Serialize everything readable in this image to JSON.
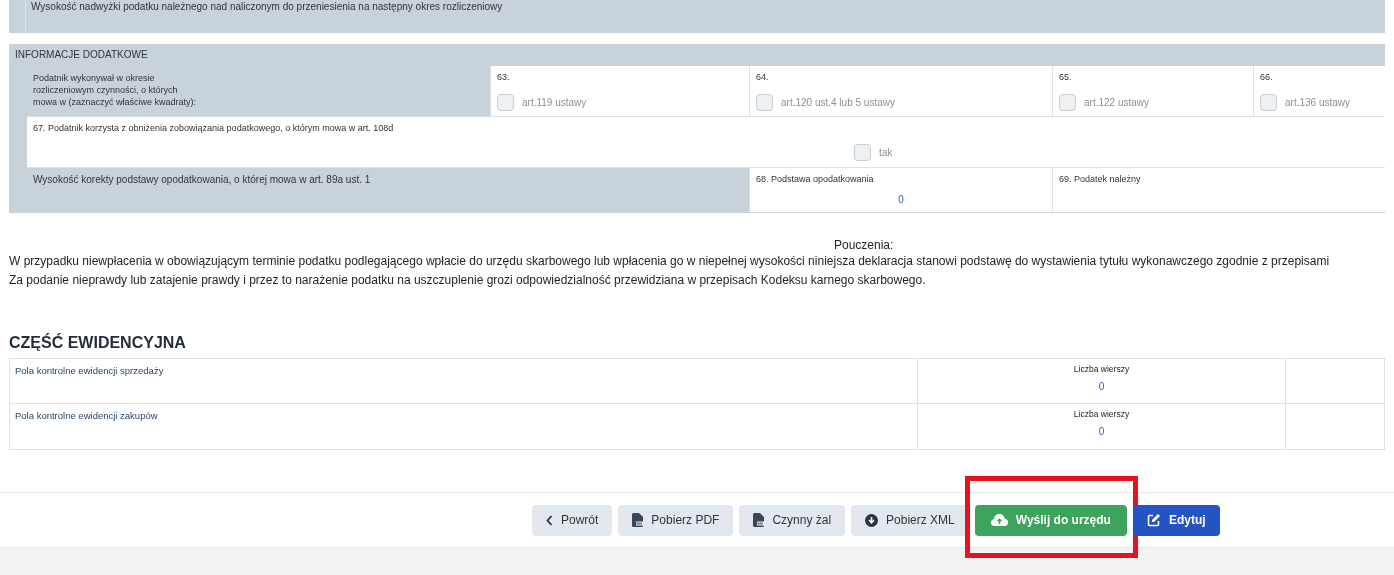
{
  "carry_over": {
    "label": "Wysokość nadwyżki podatku należnego nad naliczonym do przeniesienia na następny okres rozliczeniowy"
  },
  "additional_info": {
    "title": "INFORMACJE DODATKOWE",
    "activities": {
      "label": "Podatnik wykonywał w okresie rozliczeniowym czynności, o których mowa w (zaznaczyć właściwe kwadraty):",
      "fields": [
        {
          "number": "63.",
          "option": "art.119 ustawy",
          "checked": false
        },
        {
          "number": "64.",
          "option": "art.120 ust.4 lub 5 ustawy",
          "checked": false
        },
        {
          "number": "65.",
          "option": "art.122 ustawy",
          "checked": false
        },
        {
          "number": "66.",
          "option": "art.136 ustawy",
          "checked": false
        }
      ]
    },
    "reduction": {
      "label": "67. Podatnik korzysta z obniżenia zobowiązania podatkowego, o którym mowa w art. 108d",
      "option": "tak",
      "checked": false
    },
    "correction": {
      "label": "Wysokość korekty podstawy opodatkowania, o której mowa w art. 89a ust. 1",
      "fields": [
        {
          "label": "68. Podstawa opodatkowania",
          "value": "0"
        },
        {
          "label": "69. Podatek należny"
        }
      ]
    }
  },
  "instructions": {
    "title": "Pouczenia:",
    "paragraphs": [
      "W przypadku niewpłacenia w obowiązującym terminie podatku podlegającego wpłacie do urzędu skarbowego lub wpłacenia go w niepełnej wysokości niniejsza deklaracja stanowi podstawę do wystawienia tytułu wykonawczego zgodnie z przepisami",
      "Za podanie nieprawdy lub zatajenie prawdy i przez to narażenie podatku na uszczuplenie grozi odpowiedzialność przewidziana w przepisach Kodeksu karnego skarbowego."
    ]
  },
  "records": {
    "title": "CZĘŚĆ EWIDENCYJNA",
    "rows": [
      {
        "label": "Pola kontrolne ewidencji sprzedaży",
        "count_label": "Liczba wierszy",
        "count": "0"
      },
      {
        "label": "Pola kontrolne ewidencji zakupów",
        "count_label": "Liczba wierszy",
        "count": "0"
      }
    ]
  },
  "actions": [
    {
      "label": "Powrót",
      "kind": "back",
      "highlighted": false
    },
    {
      "label": "Pobierz PDF",
      "kind": "pdf",
      "highlighted": false
    },
    {
      "label": "Czynny żal",
      "kind": "pdf",
      "highlighted": false
    },
    {
      "label": "Pobierz XML",
      "kind": "xml",
      "highlighted": false
    },
    {
      "label": "Wyślij do urzędu",
      "kind": "send",
      "highlighted": true
    },
    {
      "label": "Edytuj",
      "kind": "edit",
      "highlighted": false
    }
  ]
}
